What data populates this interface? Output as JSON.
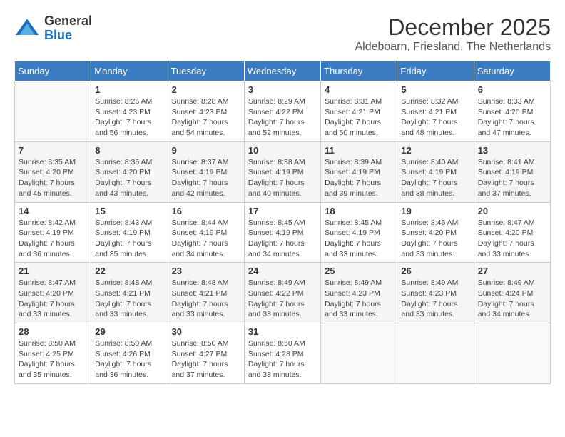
{
  "logo": {
    "text_general": "General",
    "text_blue": "Blue"
  },
  "title": "December 2025",
  "subtitle": "Aldeboarn, Friesland, The Netherlands",
  "days_of_week": [
    "Sunday",
    "Monday",
    "Tuesday",
    "Wednesday",
    "Thursday",
    "Friday",
    "Saturday"
  ],
  "weeks": [
    [
      {
        "day": "",
        "info": ""
      },
      {
        "day": "1",
        "info": "Sunrise: 8:26 AM\nSunset: 4:23 PM\nDaylight: 7 hours\nand 56 minutes."
      },
      {
        "day": "2",
        "info": "Sunrise: 8:28 AM\nSunset: 4:23 PM\nDaylight: 7 hours\nand 54 minutes."
      },
      {
        "day": "3",
        "info": "Sunrise: 8:29 AM\nSunset: 4:22 PM\nDaylight: 7 hours\nand 52 minutes."
      },
      {
        "day": "4",
        "info": "Sunrise: 8:31 AM\nSunset: 4:21 PM\nDaylight: 7 hours\nand 50 minutes."
      },
      {
        "day": "5",
        "info": "Sunrise: 8:32 AM\nSunset: 4:21 PM\nDaylight: 7 hours\nand 48 minutes."
      },
      {
        "day": "6",
        "info": "Sunrise: 8:33 AM\nSunset: 4:20 PM\nDaylight: 7 hours\nand 47 minutes."
      }
    ],
    [
      {
        "day": "7",
        "info": "Sunrise: 8:35 AM\nSunset: 4:20 PM\nDaylight: 7 hours\nand 45 minutes."
      },
      {
        "day": "8",
        "info": "Sunrise: 8:36 AM\nSunset: 4:20 PM\nDaylight: 7 hours\nand 43 minutes."
      },
      {
        "day": "9",
        "info": "Sunrise: 8:37 AM\nSunset: 4:19 PM\nDaylight: 7 hours\nand 42 minutes."
      },
      {
        "day": "10",
        "info": "Sunrise: 8:38 AM\nSunset: 4:19 PM\nDaylight: 7 hours\nand 40 minutes."
      },
      {
        "day": "11",
        "info": "Sunrise: 8:39 AM\nSunset: 4:19 PM\nDaylight: 7 hours\nand 39 minutes."
      },
      {
        "day": "12",
        "info": "Sunrise: 8:40 AM\nSunset: 4:19 PM\nDaylight: 7 hours\nand 38 minutes."
      },
      {
        "day": "13",
        "info": "Sunrise: 8:41 AM\nSunset: 4:19 PM\nDaylight: 7 hours\nand 37 minutes."
      }
    ],
    [
      {
        "day": "14",
        "info": "Sunrise: 8:42 AM\nSunset: 4:19 PM\nDaylight: 7 hours\nand 36 minutes."
      },
      {
        "day": "15",
        "info": "Sunrise: 8:43 AM\nSunset: 4:19 PM\nDaylight: 7 hours\nand 35 minutes."
      },
      {
        "day": "16",
        "info": "Sunrise: 8:44 AM\nSunset: 4:19 PM\nDaylight: 7 hours\nand 34 minutes."
      },
      {
        "day": "17",
        "info": "Sunrise: 8:45 AM\nSunset: 4:19 PM\nDaylight: 7 hours\nand 34 minutes."
      },
      {
        "day": "18",
        "info": "Sunrise: 8:45 AM\nSunset: 4:19 PM\nDaylight: 7 hours\nand 33 minutes."
      },
      {
        "day": "19",
        "info": "Sunrise: 8:46 AM\nSunset: 4:20 PM\nDaylight: 7 hours\nand 33 minutes."
      },
      {
        "day": "20",
        "info": "Sunrise: 8:47 AM\nSunset: 4:20 PM\nDaylight: 7 hours\nand 33 minutes."
      }
    ],
    [
      {
        "day": "21",
        "info": "Sunrise: 8:47 AM\nSunset: 4:20 PM\nDaylight: 7 hours\nand 33 minutes."
      },
      {
        "day": "22",
        "info": "Sunrise: 8:48 AM\nSunset: 4:21 PM\nDaylight: 7 hours\nand 33 minutes."
      },
      {
        "day": "23",
        "info": "Sunrise: 8:48 AM\nSunset: 4:21 PM\nDaylight: 7 hours\nand 33 minutes."
      },
      {
        "day": "24",
        "info": "Sunrise: 8:49 AM\nSunset: 4:22 PM\nDaylight: 7 hours\nand 33 minutes."
      },
      {
        "day": "25",
        "info": "Sunrise: 8:49 AM\nSunset: 4:23 PM\nDaylight: 7 hours\nand 33 minutes."
      },
      {
        "day": "26",
        "info": "Sunrise: 8:49 AM\nSunset: 4:23 PM\nDaylight: 7 hours\nand 33 minutes."
      },
      {
        "day": "27",
        "info": "Sunrise: 8:49 AM\nSunset: 4:24 PM\nDaylight: 7 hours\nand 34 minutes."
      }
    ],
    [
      {
        "day": "28",
        "info": "Sunrise: 8:50 AM\nSunset: 4:25 PM\nDaylight: 7 hours\nand 35 minutes."
      },
      {
        "day": "29",
        "info": "Sunrise: 8:50 AM\nSunset: 4:26 PM\nDaylight: 7 hours\nand 36 minutes."
      },
      {
        "day": "30",
        "info": "Sunrise: 8:50 AM\nSunset: 4:27 PM\nDaylight: 7 hours\nand 37 minutes."
      },
      {
        "day": "31",
        "info": "Sunrise: 8:50 AM\nSunset: 4:28 PM\nDaylight: 7 hours\nand 38 minutes."
      },
      {
        "day": "",
        "info": ""
      },
      {
        "day": "",
        "info": ""
      },
      {
        "day": "",
        "info": ""
      }
    ]
  ]
}
